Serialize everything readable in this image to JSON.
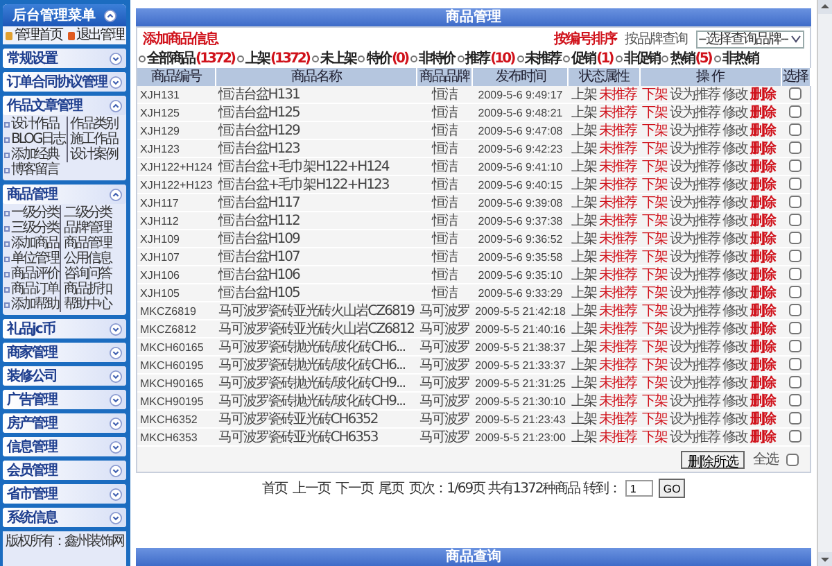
{
  "sidebar": {
    "title": "后台管理菜单",
    "links": [
      "管理首页",
      "退出管理"
    ],
    "sections": [
      {
        "title": "常规设置",
        "expanded": false
      },
      {
        "title": "订单合同协议管理",
        "expanded": false
      },
      {
        "title": "作品文章管理",
        "expanded": true,
        "items": [
          "设计作品",
          "作品类别",
          "BLOG日志",
          "施工作品",
          "添加经典",
          "设计案例",
          "博客留言"
        ]
      },
      {
        "title": "商品管理",
        "expanded": true,
        "items": [
          "一级分类",
          "二级分类",
          "三级分类",
          "品牌管理",
          "添加商品",
          "商品管理",
          "单位管理",
          "公用信息",
          "商品评价",
          "咨询问答",
          "商品订单",
          "商品折扣",
          "添加帮助",
          "帮助中心"
        ]
      },
      {
        "title": "礼品jc币",
        "expanded": false
      },
      {
        "title": "商家管理",
        "expanded": false
      },
      {
        "title": "装修公司",
        "expanded": false
      },
      {
        "title": "广告管理",
        "expanded": false
      },
      {
        "title": "房产管理",
        "expanded": false
      },
      {
        "title": "信息管理",
        "expanded": false
      },
      {
        "title": "会员管理",
        "expanded": false
      },
      {
        "title": "省市管理",
        "expanded": false
      },
      {
        "title": "系统信息",
        "expanded": false
      }
    ],
    "footer": "版权所有：鑫州装饰网"
  },
  "panel": {
    "title": "商品管理",
    "add_link": "添加商品信息",
    "sort_link": "按编号排序",
    "brand_label": "按品牌查询",
    "brand_select": "--选择查询品牌--",
    "filters": [
      {
        "label": "全部商品",
        "count": "(1372)"
      },
      {
        "label": "上架",
        "count": "(1372)"
      },
      {
        "label": "未上架"
      },
      {
        "label": "特价",
        "count": "(0)"
      },
      {
        "label": "非特价"
      },
      {
        "label": "推荐",
        "count": "(10)"
      },
      {
        "label": "未推荐"
      },
      {
        "label": "促销",
        "count": "(1)"
      },
      {
        "label": "非促销"
      },
      {
        "label": "热销",
        "count": "(5)"
      },
      {
        "label": "非热销"
      }
    ],
    "columns": [
      "商品编号",
      "商品名称",
      "商品品牌",
      "发布时间",
      "状态属性",
      "操 作",
      "选择"
    ],
    "rows": [
      {
        "code": "XJH131",
        "name": "恒洁台盆H131",
        "brand": "恒洁",
        "time": "2009-5-6 9:49:17",
        "status": "上架",
        "recommend": "未推荐",
        "actions": [
          "下架",
          "设为推荐",
          "修改",
          "删除"
        ],
        "checked": false
      },
      {
        "code": "XJH125",
        "name": "恒洁台盆H125",
        "brand": "恒洁",
        "time": "2009-5-6 9:48:21",
        "status": "上架",
        "recommend": "未推荐",
        "actions": [
          "下架",
          "设为推荐",
          "修改",
          "删除"
        ],
        "checked": false
      },
      {
        "code": "XJH129",
        "name": "恒洁台盆H129",
        "brand": "恒洁",
        "time": "2009-5-6 9:47:08",
        "status": "上架",
        "recommend": "未推荐",
        "actions": [
          "下架",
          "设为推荐",
          "修改",
          "删除"
        ],
        "checked": false
      },
      {
        "code": "XJH123",
        "name": "恒洁台盆H123",
        "brand": "恒洁",
        "time": "2009-5-6 9:42:23",
        "status": "上架",
        "recommend": "未推荐",
        "actions": [
          "下架",
          "设为推荐",
          "修改",
          "删除"
        ],
        "checked": false
      },
      {
        "code": "XJH122+H124",
        "name": "恒洁台盆+毛巾架H122+H124",
        "brand": "恒洁",
        "time": "2009-5-6 9:41:10",
        "status": "上架",
        "recommend": "未推荐",
        "actions": [
          "下架",
          "设为推荐",
          "修改",
          "删除"
        ],
        "checked": false
      },
      {
        "code": "XJH122+H123",
        "name": "恒洁台盆+毛巾架H122+H123",
        "brand": "恒洁",
        "time": "2009-5-6 9:40:15",
        "status": "上架",
        "recommend": "未推荐",
        "actions": [
          "下架",
          "设为推荐",
          "修改",
          "删除"
        ],
        "checked": false
      },
      {
        "code": "XJH117",
        "name": "恒洁台盆H117",
        "brand": "恒洁",
        "time": "2009-5-6 9:39:08",
        "status": "上架",
        "recommend": "未推荐",
        "actions": [
          "下架",
          "设为推荐",
          "修改",
          "删除"
        ],
        "checked": false
      },
      {
        "code": "XJH112",
        "name": "恒洁台盆H112",
        "brand": "恒洁",
        "time": "2009-5-6 9:37:38",
        "status": "上架",
        "recommend": "未推荐",
        "actions": [
          "下架",
          "设为推荐",
          "修改",
          "删除"
        ],
        "checked": false
      },
      {
        "code": "XJH109",
        "name": "恒洁台盆H109",
        "brand": "恒洁",
        "time": "2009-5-6 9:36:52",
        "status": "上架",
        "recommend": "未推荐",
        "actions": [
          "下架",
          "设为推荐",
          "修改",
          "删除"
        ],
        "checked": false
      },
      {
        "code": "XJH107",
        "name": "恒洁台盆H107",
        "brand": "恒洁",
        "time": "2009-5-6 9:35:58",
        "status": "上架",
        "recommend": "未推荐",
        "actions": [
          "下架",
          "设为推荐",
          "修改",
          "删除"
        ],
        "checked": false
      },
      {
        "code": "XJH106",
        "name": "恒洁台盆H106",
        "brand": "恒洁",
        "time": "2009-5-6 9:35:10",
        "status": "上架",
        "recommend": "未推荐",
        "actions": [
          "下架",
          "设为推荐",
          "修改",
          "删除"
        ],
        "checked": false
      },
      {
        "code": "XJH105",
        "name": "恒洁台盆H105",
        "brand": "恒洁",
        "time": "2009-5-6 9:33:29",
        "status": "上架",
        "recommend": "未推荐",
        "actions": [
          "下架",
          "设为推荐",
          "修改",
          "删除"
        ],
        "checked": false
      },
      {
        "code": "MKCZ6819",
        "name": "马可波罗瓷砖亚光砖火山岩CZ6819",
        "brand": "马可波罗",
        "time": "2009-5-5 21:42:18",
        "status": "上架",
        "recommend": "未推荐",
        "actions": [
          "下架",
          "设为推荐",
          "修改",
          "删除"
        ],
        "checked": false
      },
      {
        "code": "MKCZ6812",
        "name": "马可波罗瓷砖亚光砖火山岩CZ6812",
        "brand": "马可波罗",
        "time": "2009-5-5 21:40:16",
        "status": "上架",
        "recommend": "未推荐",
        "actions": [
          "下架",
          "设为推荐",
          "修改",
          "删除"
        ],
        "checked": false
      },
      {
        "code": "MKCH60165",
        "name": "马可波罗瓷砖抛光砖/玻化砖CH6...",
        "brand": "马可波罗",
        "time": "2009-5-5 21:38:37",
        "status": "上架",
        "recommend": "未推荐",
        "actions": [
          "下架",
          "设为推荐",
          "修改",
          "删除"
        ],
        "checked": false
      },
      {
        "code": "MKCH60195",
        "name": "马可波罗瓷砖抛光砖/玻化砖CH6...",
        "brand": "马可波罗",
        "time": "2009-5-5 21:33:37",
        "status": "上架",
        "recommend": "未推荐",
        "actions": [
          "下架",
          "设为推荐",
          "修改",
          "删除"
        ],
        "checked": false
      },
      {
        "code": "MKCH90165",
        "name": "马可波罗瓷砖抛光砖/玻化砖CH9...",
        "brand": "马可波罗",
        "time": "2009-5-5 21:31:25",
        "status": "上架",
        "recommend": "未推荐",
        "actions": [
          "下架",
          "设为推荐",
          "修改",
          "删除"
        ],
        "checked": false
      },
      {
        "code": "MKCH90195",
        "name": "马可波罗瓷砖抛光砖/玻化砖CH9...",
        "brand": "马可波罗",
        "time": "2009-5-5 21:30:10",
        "status": "上架",
        "recommend": "未推荐",
        "actions": [
          "下架",
          "设为推荐",
          "修改",
          "删除"
        ],
        "checked": false
      },
      {
        "code": "MKCH6352",
        "name": "马可波罗瓷砖亚光砖CH6352",
        "brand": "马可波罗",
        "time": "2009-5-5 21:23:43",
        "status": "上架",
        "recommend": "未推荐",
        "actions": [
          "下架",
          "设为推荐",
          "修改",
          "删除"
        ],
        "checked": false
      },
      {
        "code": "MKCH6353",
        "name": "马可波罗瓷砖亚光砖CH6353",
        "brand": "马可波罗",
        "time": "2009-5-5 21:23:00",
        "status": "上架",
        "recommend": "未推荐",
        "actions": [
          "下架",
          "设为推荐",
          "修改",
          "删除"
        ],
        "checked": false
      }
    ],
    "delete_button": "删除所选",
    "select_all": {
      "label": "全选",
      "checked": false
    }
  },
  "pagination": {
    "links": [
      "首页",
      "上一页",
      "下一页",
      "尾页"
    ],
    "info": "页次：1/69页 共有1372种商品 转到：",
    "page_input": "1",
    "go_button": "GO"
  },
  "search_panel": {
    "title": "商品查询"
  }
}
